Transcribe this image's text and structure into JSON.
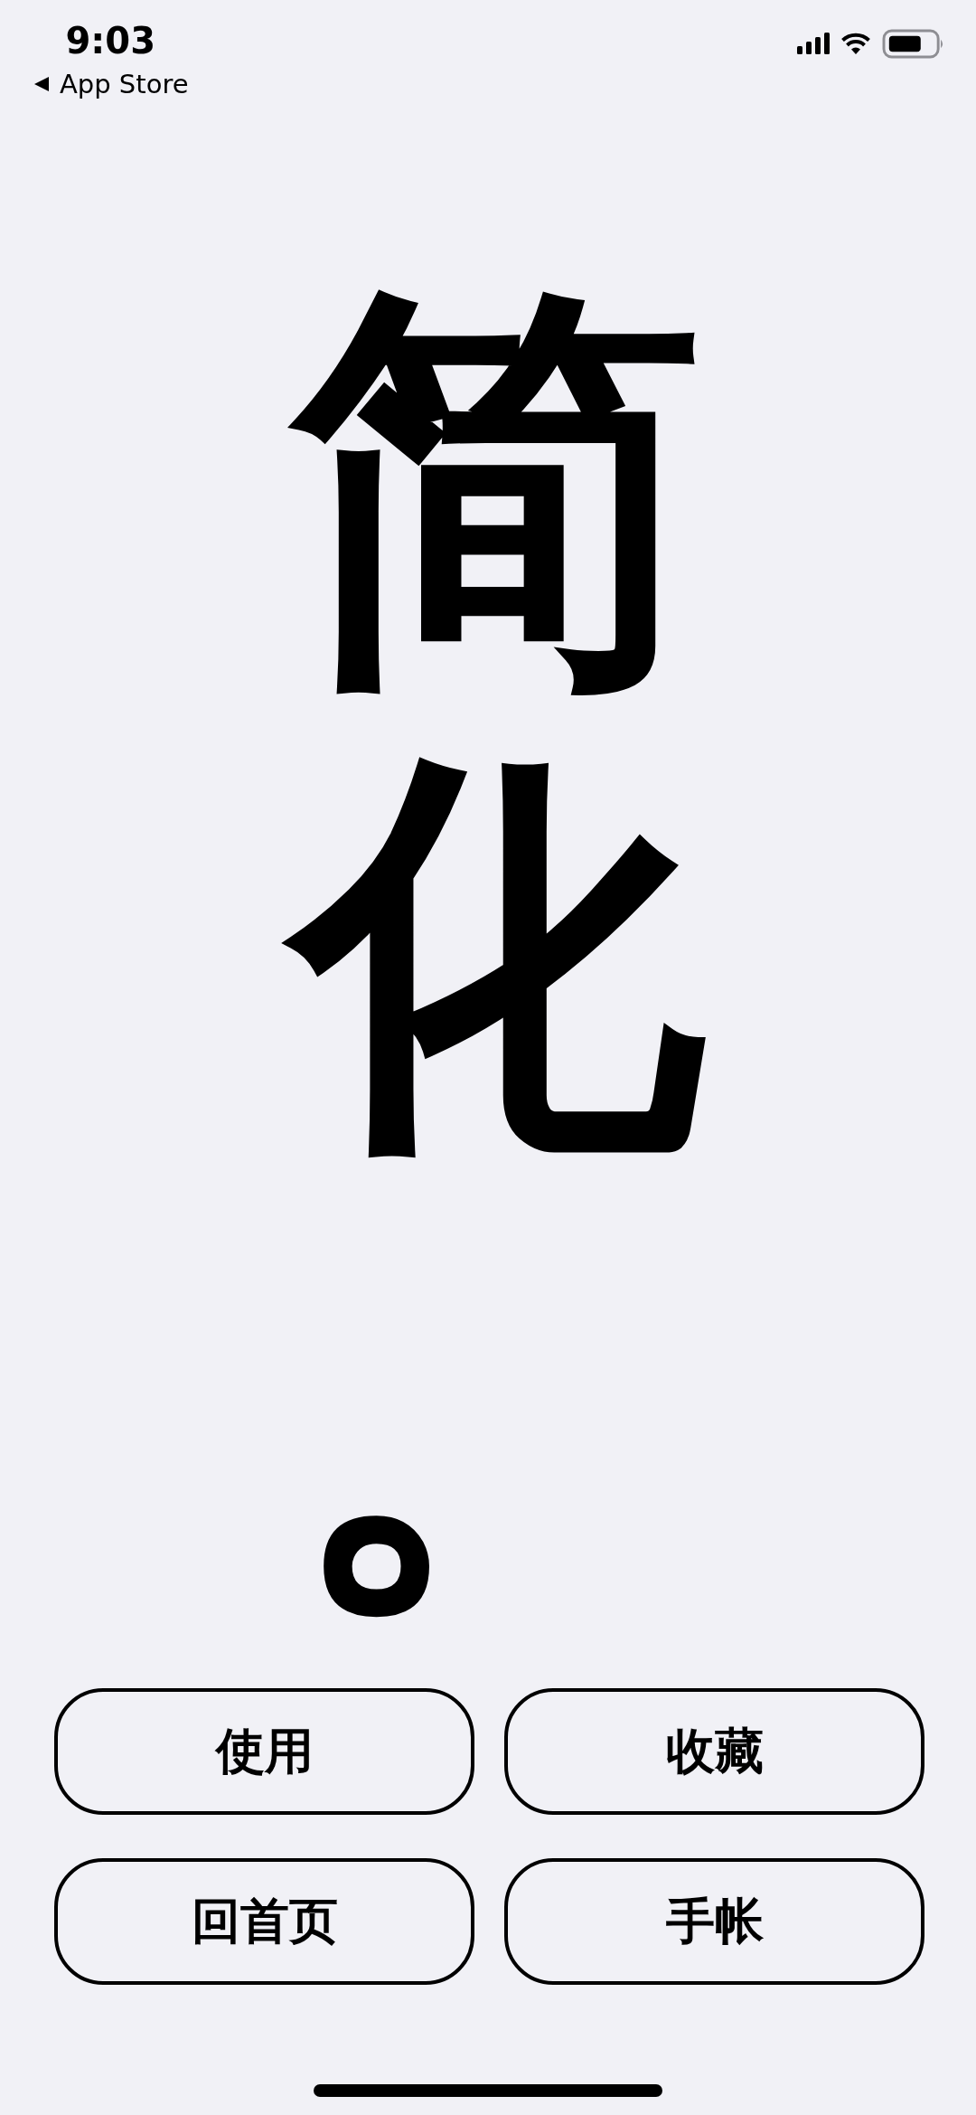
{
  "status_bar": {
    "time": "9:03",
    "back_label": "App Store"
  },
  "slogan": {
    "main": "简化。"
  },
  "buttons": [
    {
      "label": "使用"
    },
    {
      "label": "收藏"
    },
    {
      "label": "回首页"
    },
    {
      "label": "手帐"
    }
  ]
}
